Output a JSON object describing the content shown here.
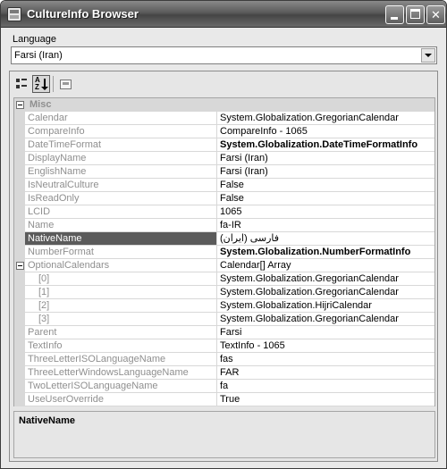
{
  "window": {
    "title": "CultureInfo Browser"
  },
  "language": {
    "label": "Language",
    "selected": "Farsi (Iran)"
  },
  "grid": {
    "category": "Misc",
    "rows": [
      {
        "name": "Calendar",
        "value": "System.Globalization.GregorianCalendar",
        "bold": false
      },
      {
        "name": "CompareInfo",
        "value": "CompareInfo - 1065",
        "bold": false
      },
      {
        "name": "DateTimeFormat",
        "value": "System.Globalization.DateTimeFormatInfo",
        "bold": true
      },
      {
        "name": "DisplayName",
        "value": "Farsi (Iran)",
        "bold": false
      },
      {
        "name": "EnglishName",
        "value": "Farsi (Iran)",
        "bold": false
      },
      {
        "name": "IsNeutralCulture",
        "value": "False",
        "bold": false
      },
      {
        "name": "IsReadOnly",
        "value": "False",
        "bold": false
      },
      {
        "name": "LCID",
        "value": "1065",
        "bold": false
      },
      {
        "name": "Name",
        "value": "fa-IR",
        "bold": false
      },
      {
        "name": "NativeName",
        "value": "فارسى (ايران)",
        "bold": false,
        "selected": true
      },
      {
        "name": "NumberFormat",
        "value": "System.Globalization.NumberFormatInfo",
        "bold": true
      },
      {
        "name": "OptionalCalendars",
        "value": "Calendar[] Array",
        "bold": false,
        "expandable": true
      },
      {
        "name": "[0]",
        "value": "System.Globalization.GregorianCalendar",
        "bold": false,
        "child": true
      },
      {
        "name": "[1]",
        "value": "System.Globalization.GregorianCalendar",
        "bold": false,
        "child": true
      },
      {
        "name": "[2]",
        "value": "System.Globalization.HijriCalendar",
        "bold": false,
        "child": true
      },
      {
        "name": "[3]",
        "value": "System.Globalization.GregorianCalendar",
        "bold": false,
        "child": true
      },
      {
        "name": "Parent",
        "value": "Farsi",
        "bold": false
      },
      {
        "name": "TextInfo",
        "value": "TextInfo - 1065",
        "bold": false
      },
      {
        "name": "ThreeLetterISOLanguageName",
        "value": "fas",
        "bold": false
      },
      {
        "name": "ThreeLetterWindowsLanguageName",
        "value": "FAR",
        "bold": false
      },
      {
        "name": "TwoLetterISOLanguageName",
        "value": "fa",
        "bold": false
      },
      {
        "name": "UseUserOverride",
        "value": "True",
        "bold": false
      }
    ]
  },
  "help": {
    "title": "NativeName"
  },
  "icons": {
    "categorized": "categorized-icon",
    "alphabetical": "alphabetical-sort-icon",
    "property_pages": "property-pages-icon"
  }
}
